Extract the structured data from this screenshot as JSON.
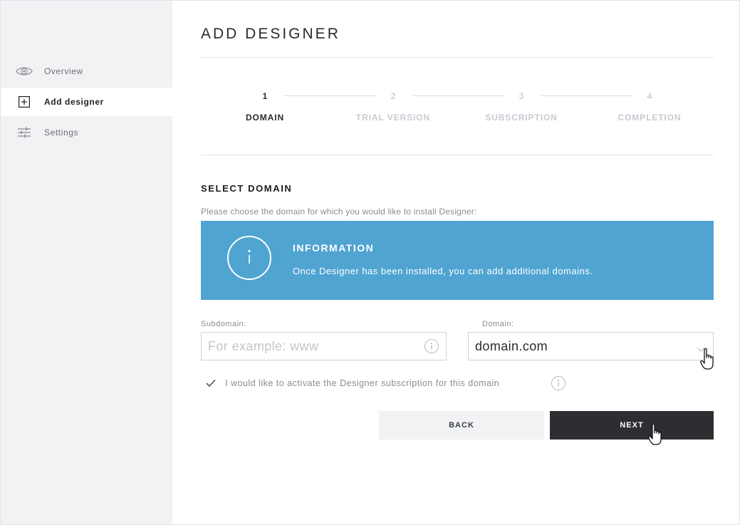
{
  "sidebar": {
    "items": [
      {
        "label": "Overview",
        "icon": "eye-icon",
        "active": false
      },
      {
        "label": "Add designer",
        "icon": "plus-square-icon",
        "active": true
      },
      {
        "label": "Settings",
        "icon": "sliders-icon",
        "active": false
      }
    ]
  },
  "page": {
    "title": "ADD DESIGNER"
  },
  "stepper": {
    "steps": [
      {
        "number": "1",
        "label": "DOMAIN",
        "active": true
      },
      {
        "number": "2",
        "label": "TRIAL VERSION",
        "active": false
      },
      {
        "number": "3",
        "label": "SUBSCRIPTION",
        "active": false
      },
      {
        "number": "4",
        "label": "COMPLETION",
        "active": false
      }
    ]
  },
  "section": {
    "title": "SELECT DOMAIN",
    "description": "Please choose the domain for which you would like to install Designer:"
  },
  "info": {
    "title": "INFORMATION",
    "text": "Once Designer has been installed, you can add additional domains.",
    "icon": "info-icon",
    "color": "#50a4d1"
  },
  "form": {
    "subdomain": {
      "label": "Subdomain:",
      "placeholder": "For example: www",
      "value": ""
    },
    "domain": {
      "label": "Domain:",
      "selected": "domain.com"
    },
    "subscription_checkbox": {
      "label": "I would like to activate the Designer subscription for this domain",
      "checked": true
    }
  },
  "buttons": {
    "back": "BACK",
    "next": "NEXT"
  },
  "colors": {
    "accent": "#50a4d1",
    "primary_button": "#2d2e31",
    "sidebar_bg": "#f1f2f4"
  }
}
